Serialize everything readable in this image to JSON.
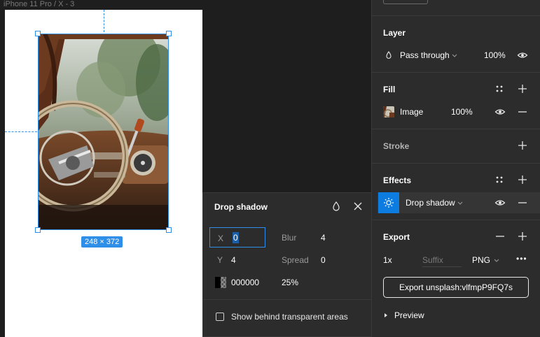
{
  "canvas": {
    "frame_label": "iPhone 11 Pro / X - 3",
    "size_badge": "248 × 372"
  },
  "popover": {
    "title": "Drop shadow",
    "x_label": "X",
    "x_value": "0",
    "y_label": "Y",
    "y_value": "4",
    "blur_label": "Blur",
    "blur_value": "4",
    "spread_label": "Spread",
    "spread_value": "0",
    "color_hex": "000000",
    "opacity": "25%",
    "checkbox_label": "Show behind transparent areas"
  },
  "layer": {
    "title": "Layer",
    "blend_mode": "Pass through",
    "opacity": "100%"
  },
  "fill": {
    "title": "Fill",
    "type": "Image",
    "opacity": "100%"
  },
  "stroke": {
    "title": "Stroke"
  },
  "effects": {
    "title": "Effects",
    "effect_name": "Drop shadow"
  },
  "export": {
    "title": "Export",
    "scale": "1x",
    "suffix_placeholder": "Suffix",
    "format": "PNG",
    "more": "•••",
    "button_label": "Export unsplash:vlfmpP9FQ7s",
    "preview_label": "Preview"
  },
  "colors": {
    "accent": "#0d7ce0",
    "selection": "#2f8ee8",
    "panel_bg": "#2c2c2c",
    "canvas_bg": "#1e1e1e"
  }
}
